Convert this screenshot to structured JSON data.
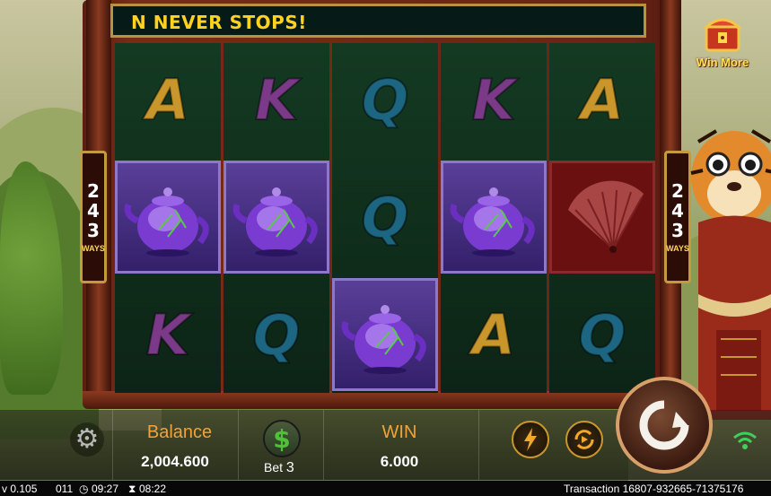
{
  "banner": {
    "marquee_text": "N NEVER STOPS!"
  },
  "win_more": {
    "label": "Win More"
  },
  "ways": {
    "digits": [
      "2",
      "4",
      "3"
    ],
    "label": "WAYS"
  },
  "reels": [
    [
      "A",
      "teapot",
      "K"
    ],
    [
      "K",
      "teapot",
      "Q"
    ],
    [
      "Q",
      "Q",
      "teapot"
    ],
    [
      "K",
      "teapot",
      "A"
    ],
    [
      "A",
      "fan",
      "Q"
    ]
  ],
  "symbol_colors": {
    "A": "#c8962b",
    "K": "#7a3a88",
    "Q": "#1d6682"
  },
  "balance": {
    "label": "Balance",
    "value": "2,004.600"
  },
  "bet": {
    "label": "Bet",
    "value": "3",
    "icon": "dollar-icon"
  },
  "win": {
    "label": "WIN",
    "value": "6.000"
  },
  "icons": {
    "settings": "gear-icon",
    "turbo": "lightning-icon",
    "autoplay": "autoplay-icon",
    "spin": "spin-arrow-icon",
    "signal": "wifi-icon"
  },
  "status_bar": {
    "version": "v 0.105",
    "code": "011",
    "clock_time": "09:27",
    "timer_time": "08:22",
    "transaction": "Transaction 16807-932665-71375176"
  }
}
